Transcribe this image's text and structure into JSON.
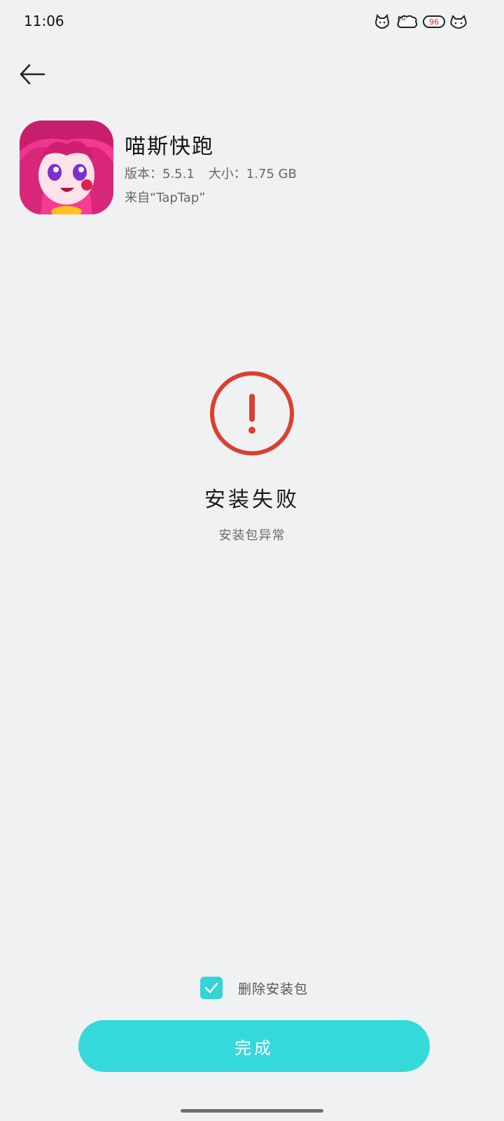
{
  "status_bar": {
    "time": "11:06",
    "battery": "96",
    "icons": [
      "cat-face-icon",
      "cat-cloud-signal-icon",
      "battery-icon",
      "cat-wifi-icon"
    ]
  },
  "navigation": {
    "back_icon": "arrow-left-icon"
  },
  "app": {
    "name": "喵斯快跑",
    "version_label": "版本：5.5.1",
    "size_label": "大小：1.75 GB",
    "source_label": "来自“TapTap”",
    "icon": "app-icon-anime-girl"
  },
  "result": {
    "icon": "error-circle-icon",
    "title": "安装失败",
    "subtitle": "安装包异常",
    "color": "#d9402f"
  },
  "options": {
    "delete_package_label": "删除安装包",
    "delete_package_checked": true
  },
  "actions": {
    "done_label": "完成",
    "accent_color": "#35d9da"
  }
}
